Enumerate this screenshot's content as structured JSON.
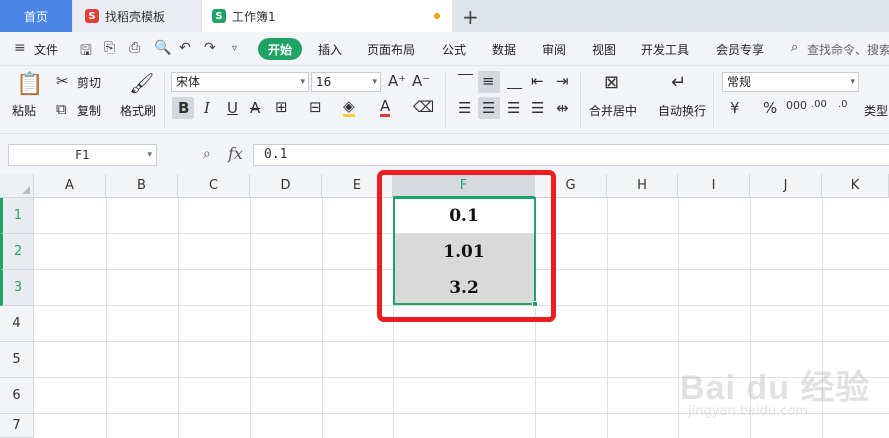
{
  "tabs": [
    {
      "label": "首页"
    },
    {
      "label": "找稻壳模板",
      "logo": "S"
    },
    {
      "label": "工作簿1",
      "logo": "S"
    }
  ],
  "menu": {
    "file": "文件",
    "items": [
      "开始",
      "插入",
      "页面布局",
      "公式",
      "数据",
      "审阅",
      "视图",
      "开发工具",
      "会员专享"
    ],
    "search_placeholder": "查找命令、搜索"
  },
  "ribbon": {
    "paste": "粘贴",
    "cut": "剪切",
    "copy": "复制",
    "format_painter": "格式刷",
    "font_name": "宋体",
    "font_size": "16",
    "merge_center": "合并居中",
    "wrap_text": "自动换行",
    "number_format": "常规",
    "type_convert": "类型"
  },
  "formula_bar": {
    "name_box": "F1",
    "fx": "fx",
    "content": "0.1"
  },
  "grid": {
    "columns": [
      "A",
      "B",
      "C",
      "D",
      "E",
      "F",
      "G",
      "H",
      "I",
      "J",
      "K"
    ],
    "rows": [
      "1",
      "2",
      "3",
      "4",
      "5",
      "6",
      "7"
    ],
    "selected_column": "F",
    "cells_F": [
      "0.1",
      "1.01",
      "3.2"
    ]
  },
  "watermark": {
    "brand": "Bai du 经验",
    "url": "jingyan.baidu.com"
  },
  "colors": {
    "accent_green": "#21a366",
    "tab_blue": "#4a86e8",
    "highlight_red": "#ee1c1c",
    "cell_gray": "#d9d9d9"
  }
}
